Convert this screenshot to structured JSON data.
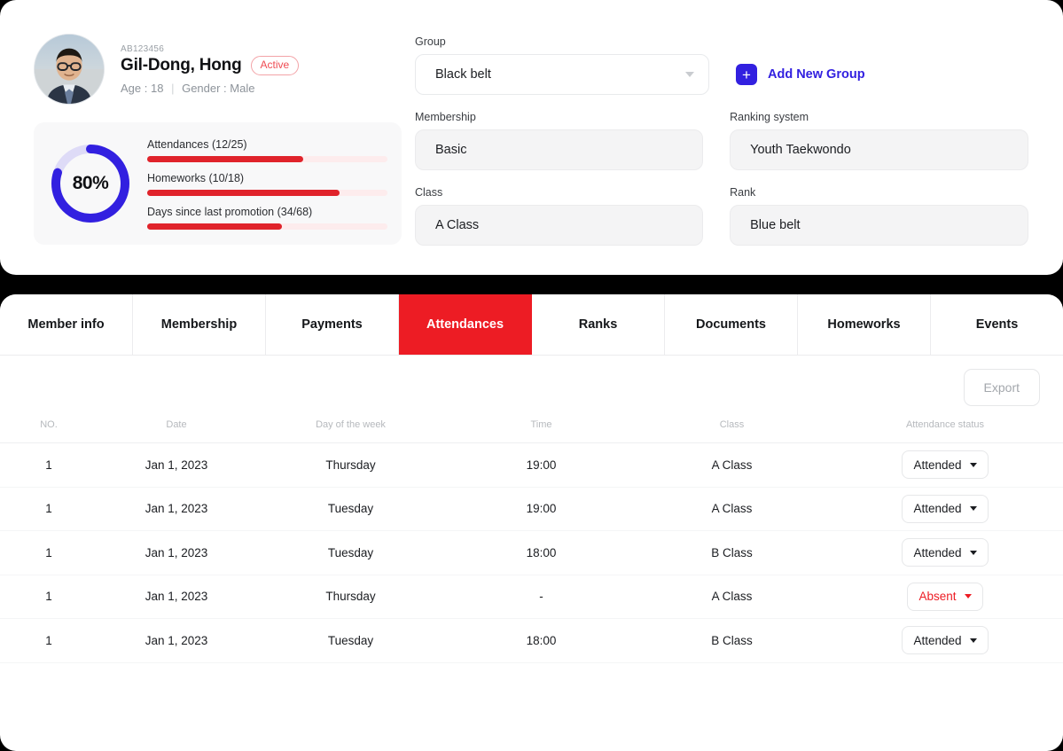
{
  "profile": {
    "member_id": "AB123456",
    "name": "Gil-Dong, Hong",
    "status_badge": "Active",
    "age_label": "Age : 18",
    "separator": "|",
    "gender_label": "Gender : Male"
  },
  "stats": {
    "percent_label": "80%",
    "percent_value": 80,
    "ring_color": "#3220e0",
    "ring_track_color": "#dedbf7",
    "bar_color": "#e0232b",
    "bar_track_color": "#fdeced",
    "bars": [
      {
        "label": "Attendances (12/25)",
        "fill_percent": 65
      },
      {
        "label": "Homeworks (10/18)",
        "fill_percent": 80
      },
      {
        "label": "Days since last promotion (34/68)",
        "fill_percent": 56
      }
    ]
  },
  "form": {
    "group": {
      "label": "Group",
      "value": "Black belt",
      "caret_icon": "chevron-down-icon"
    },
    "add_group": {
      "label": "Add New Group",
      "icon": "plus-icon",
      "color": "#3220e0"
    },
    "membership": {
      "label": "Membership",
      "value": "Basic"
    },
    "ranking_system": {
      "label": "Ranking system",
      "value": "Youth Taekwondo"
    },
    "class": {
      "label": "Class",
      "value": "A Class"
    },
    "rank": {
      "label": "Rank",
      "value": "Blue belt"
    }
  },
  "tabs": {
    "active_color": "#ed1c24",
    "items": [
      {
        "label": "Member info",
        "active": false
      },
      {
        "label": "Membership",
        "active": false
      },
      {
        "label": "Payments",
        "active": false
      },
      {
        "label": "Attendances",
        "active": true
      },
      {
        "label": "Ranks",
        "active": false
      },
      {
        "label": "Documents",
        "active": false
      },
      {
        "label": "Homeworks",
        "active": false
      },
      {
        "label": "Events",
        "active": false
      }
    ]
  },
  "toolbar": {
    "export_label": "Export"
  },
  "table": {
    "columns": [
      "NO.",
      "Date",
      "Day of the week",
      "Time",
      "Class",
      "Attendance status"
    ],
    "rows": [
      {
        "no": "1",
        "date": "Jan 1, 2023",
        "day": "Thursday",
        "time": "19:00",
        "class": "A Class",
        "status": "Attended"
      },
      {
        "no": "1",
        "date": "Jan 1, 2023",
        "day": "Tuesday",
        "time": "19:00",
        "class": "A Class",
        "status": "Attended"
      },
      {
        "no": "1",
        "date": "Jan 1, 2023",
        "day": "Tuesday",
        "time": "18:00",
        "class": "B Class",
        "status": "Attended"
      },
      {
        "no": "1",
        "date": "Jan 1, 2023",
        "day": "Thursday",
        "time": "-",
        "class": "A Class",
        "status": "Absent"
      },
      {
        "no": "1",
        "date": "Jan 1, 2023",
        "day": "Tuesday",
        "time": "18:00",
        "class": "B Class",
        "status": "Attended"
      }
    ]
  }
}
